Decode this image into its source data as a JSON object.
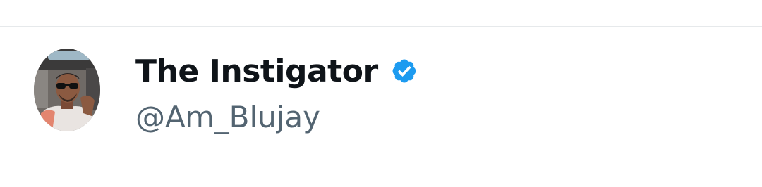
{
  "profile": {
    "display_name": "The Instigator",
    "handle": "@Am_Blujay",
    "verified": true,
    "avatar_icon": "user-avatar-photo",
    "badge_icon": "verified-badge-icon"
  },
  "colors": {
    "name_text": "#0f1419",
    "handle_text": "#536471",
    "verified_blue": "#1d9bf0",
    "divider": "#e6e9eb",
    "background": "#ffffff"
  }
}
